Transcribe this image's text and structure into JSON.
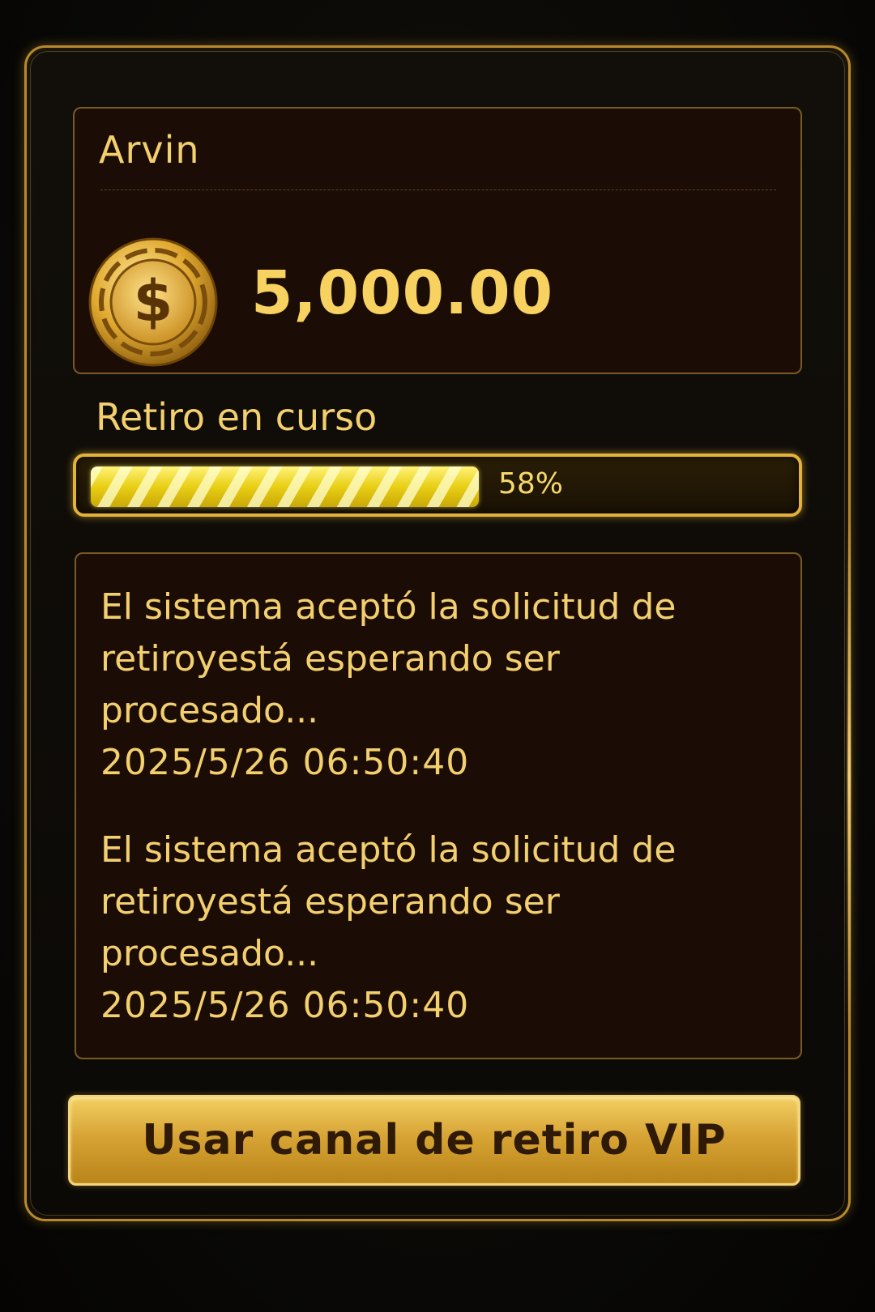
{
  "user": {
    "name": "Arvin",
    "balance": "5,000.00",
    "coin_icon": "dollar-coin-icon"
  },
  "progress": {
    "label": "Retiro en curso",
    "value": 0.58,
    "text": "58%"
  },
  "log": {
    "entries": [
      {
        "message": "El sistema aceptó la solicitud de retiroyestá esperando ser procesado...",
        "timestamp": "2025/5/26  06:50:40"
      },
      {
        "message": "El sistema aceptó la solicitud de retiroyestá esperando ser procesado...",
        "timestamp": "2025/5/26  06:50:40"
      }
    ]
  },
  "actions": {
    "vip_button_label": "Usar canal de retiro VIP"
  },
  "colors": {
    "gold_text": "#f3cf6e",
    "panel_border": "#b8892c",
    "card_background": "#1b0d06",
    "button_gold": "#d7a435"
  }
}
